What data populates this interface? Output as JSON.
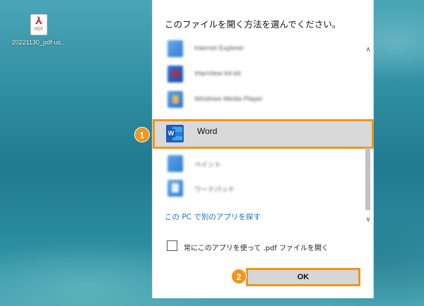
{
  "desktop": {
    "file_icon_symbol": "⅄",
    "file_icon_tag": "PDF",
    "file_label": "20221130_pdf-us..."
  },
  "dialog": {
    "title": "このファイルを開く方法を選んでください。",
    "apps": [
      {
        "name": "Internet Explorer",
        "icon": "internet-explorer-icon"
      },
      {
        "name": "IrfanView 64-bit",
        "icon": "irfanview-icon"
      },
      {
        "name": "Windows Media Player",
        "icon": "windows-media-player-icon"
      },
      {
        "name": "Word",
        "icon": "word-icon",
        "selected": true
      },
      {
        "name": "ペイント",
        "icon": "paint-icon"
      },
      {
        "name": "ワードパッド",
        "icon": "wordpad-icon"
      }
    ],
    "word_icon_letter": "W",
    "find_app_link": "この PC で別のアプリを探す",
    "always_use_label": "常にこのアプリを使って .pdf ファイルを開く",
    "always_use_checked": false,
    "ok_button": "OK",
    "scroll_up": "∧",
    "scroll_down": "∨"
  },
  "callouts": {
    "step1": "1",
    "step2": "2"
  },
  "colors": {
    "accent_orange": "#f0961c",
    "link_blue": "#1a6fc0",
    "selection_gray": "#d9d9d9"
  }
}
